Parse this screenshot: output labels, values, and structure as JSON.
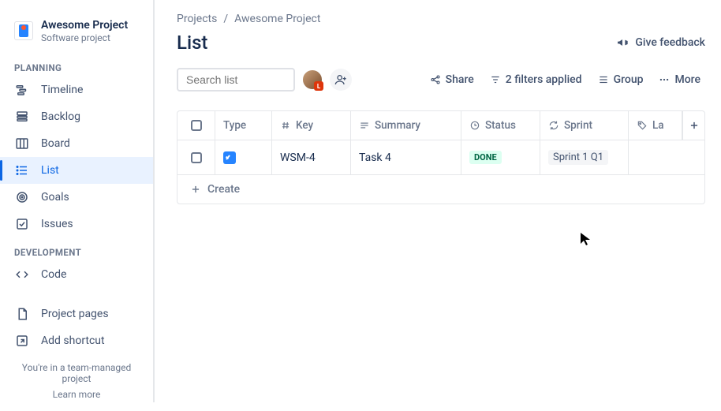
{
  "project": {
    "name": "Awesome Project",
    "subtitle": "Software project"
  },
  "sidebar": {
    "sections": {
      "planning_label": "PLANNING",
      "development_label": "DEVELOPMENT"
    },
    "planning": [
      {
        "label": "Timeline"
      },
      {
        "label": "Backlog"
      },
      {
        "label": "Board"
      },
      {
        "label": "List"
      },
      {
        "label": "Goals"
      },
      {
        "label": "Issues"
      }
    ],
    "development": [
      {
        "label": "Code"
      }
    ],
    "extras": [
      {
        "label": "Project pages"
      },
      {
        "label": "Add shortcut"
      }
    ],
    "footer_text": "You're in a team-managed project",
    "footer_link": "Learn more"
  },
  "breadcrumb": {
    "root": "Projects",
    "current": "Awesome Project"
  },
  "page_title": "List",
  "feedback_label": "Give feedback",
  "search": {
    "placeholder": "Search list"
  },
  "avatar_badge": "L",
  "toolbar": {
    "share": "Share",
    "filters": "2 filters applied",
    "group": "Group",
    "more": "More"
  },
  "columns": {
    "type": "Type",
    "key": "Key",
    "summary": "Summary",
    "status": "Status",
    "sprint": "Sprint",
    "la": "La"
  },
  "rows": [
    {
      "key": "WSM-4",
      "summary": "Task 4",
      "status": "DONE",
      "sprint": "Sprint 1 Q1"
    }
  ],
  "create_label": "Create"
}
